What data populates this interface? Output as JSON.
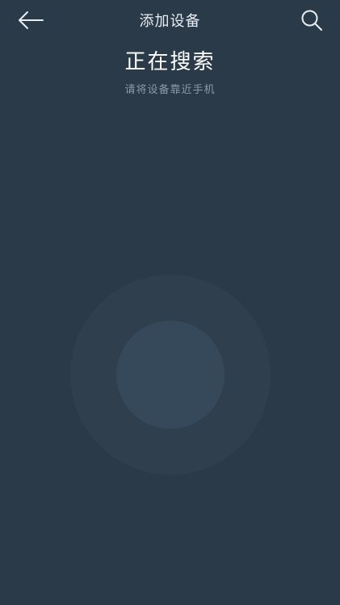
{
  "nav": {
    "title": "添加设备",
    "back_icon": "arrow-left-icon",
    "search_icon": "search-icon"
  },
  "status": {
    "heading": "正在搜索",
    "hint": "请将设备靠近手机"
  },
  "colors": {
    "background": "#2b3a48",
    "radar_outer": "#2f3f4e",
    "radar_inner": "#36495a",
    "title_text": "#ffffff",
    "hint_text": "#8c9aa8"
  }
}
